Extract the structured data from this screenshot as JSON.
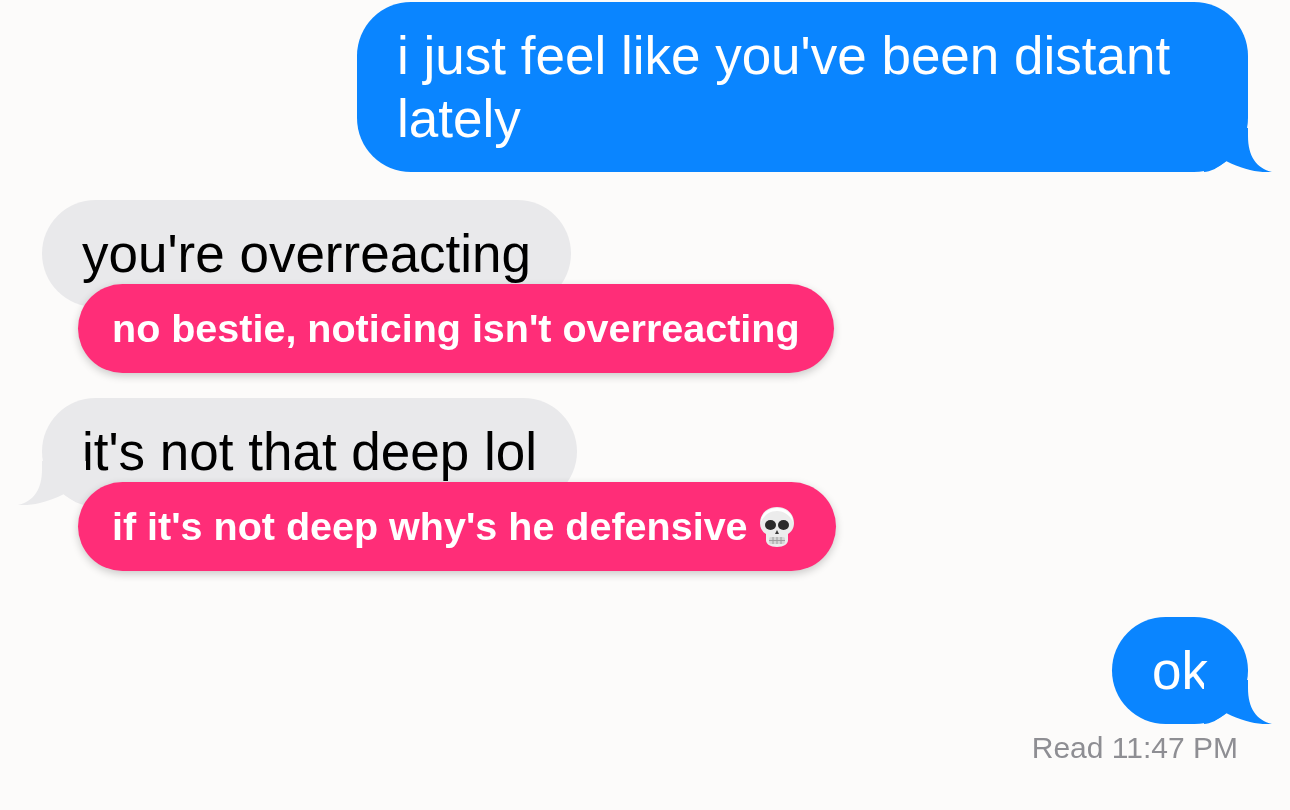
{
  "messages": [
    {
      "kind": "sent",
      "text": "i just feel like you've been distant lately",
      "tail": true
    },
    {
      "kind": "received",
      "text": "you're overreacting",
      "tail": false,
      "annotation": {
        "kind": "plain",
        "text": "no bestie, noticing isn't overreacting"
      }
    },
    {
      "kind": "received",
      "text": "it's not that deep lol",
      "tail": true,
      "annotation": {
        "kind": "with_emoji",
        "text": "if it's not deep why's he defensive"
      }
    },
    {
      "kind": "sent",
      "text": "ok",
      "tail": true
    }
  ],
  "read_receipt": "Read 11:47 PM"
}
